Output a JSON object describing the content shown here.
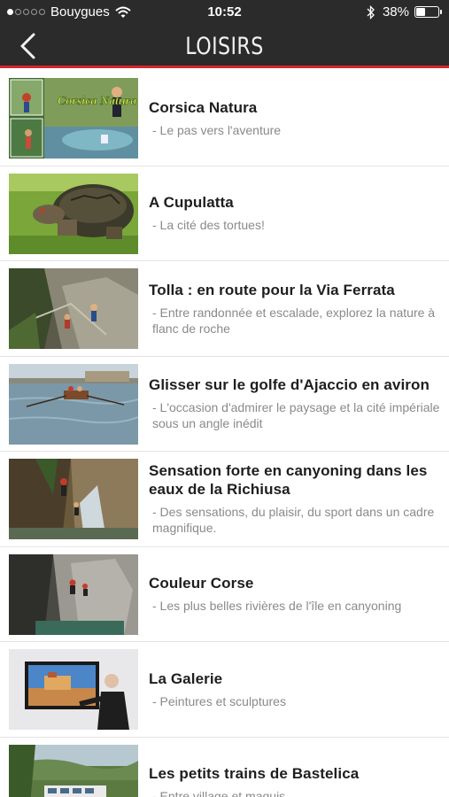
{
  "status_bar": {
    "carrier": "Bouygues",
    "time": "10:52",
    "battery": "38%",
    "battery_level": 0.38
  },
  "navbar": {
    "title": "LOISIRS",
    "back_icon": "chevron-left-icon"
  },
  "accent_color": "#d3262d",
  "items": [
    {
      "title": "Corsica Natura",
      "subtitle": "- Le pas vers l'aventure",
      "thumb_text": "Corsica Natura"
    },
    {
      "title": "A Cupulatta",
      "subtitle": "- La cité des tortues!"
    },
    {
      "title": "Tolla : en route pour la Via Ferrata",
      "subtitle": "- Entre randonnée et escalade, explorez la nature à flanc de roche"
    },
    {
      "title": "Glisser sur le golfe d'Ajaccio en aviron",
      "subtitle": "- L'occasion d'admirer le paysage et la cité impériale sous un angle inédit"
    },
    {
      "title": "Sensation forte en canyoning dans les eaux de la Richiusa",
      "subtitle": "- Des sensations, du plaisir, du sport dans un cadre magnifique."
    },
    {
      "title": "Couleur Corse",
      "subtitle": "- Les plus belles rivières de l'île en canyoning"
    },
    {
      "title": "La Galerie",
      "subtitle": "- Peintures et sculptures"
    },
    {
      "title": "Les petits trains de Bastelica",
      "subtitle": "- Entre village et maquis"
    }
  ]
}
